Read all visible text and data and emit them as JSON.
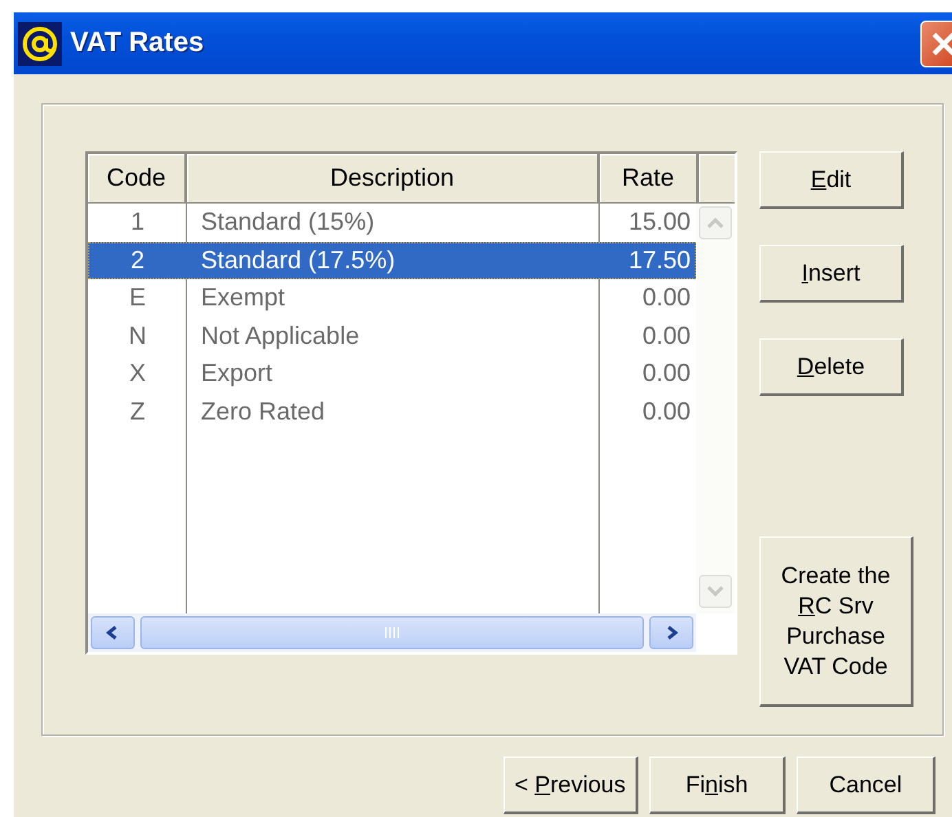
{
  "window": {
    "title": "VAT Rates"
  },
  "table": {
    "columns": [
      "Code",
      "Description",
      "Rate"
    ],
    "rows": [
      {
        "code": "1",
        "description": "Standard (15%)",
        "rate": "15.00",
        "selected": false
      },
      {
        "code": "2",
        "description": "Standard (17.5%)",
        "rate": "17.50",
        "selected": true
      },
      {
        "code": "E",
        "description": "Exempt",
        "rate": "0.00",
        "selected": false
      },
      {
        "code": "N",
        "description": "Not Applicable",
        "rate": "0.00",
        "selected": false
      },
      {
        "code": "X",
        "description": "Export",
        "rate": "0.00",
        "selected": false
      },
      {
        "code": "Z",
        "description": "Zero Rated",
        "rate": "0.00",
        "selected": false
      }
    ]
  },
  "side_buttons": [
    {
      "key": "E",
      "after": "dit"
    },
    {
      "key": "I",
      "after": "nsert"
    },
    {
      "key": "D",
      "after": "elete"
    }
  ],
  "create_button": {
    "before": "Create the ",
    "key": "R",
    "after": "C Srv Purchase VAT Code"
  },
  "footer_buttons": [
    {
      "before": "< ",
      "key": "P",
      "after": "revious"
    },
    {
      "before": "Fi",
      "key": "n",
      "after": "ish"
    },
    {
      "before": "Cancel"
    }
  ]
}
